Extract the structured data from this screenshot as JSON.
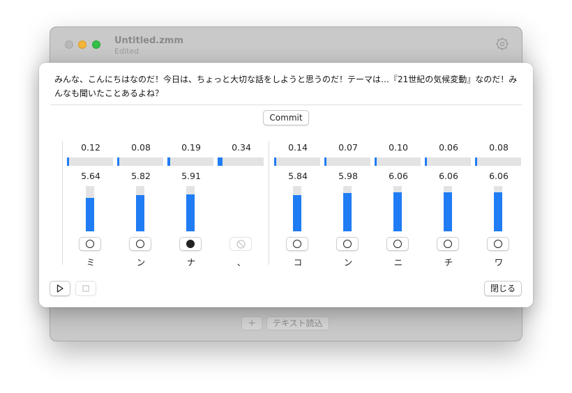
{
  "window": {
    "title": "Untitled.zmm",
    "subtitle": "Edited",
    "settings_icon": "gear-icon",
    "bottom_add_label": "＋",
    "bottom_read_label": "テキスト読込"
  },
  "sheet": {
    "text": "みんな、こんにちはなのだ！今日は、ちょっと大切な話をしようと思うのだ！テーマは…『21世紀の気候変動』なのだ！みんなも聞いたことあるよね？",
    "commit_label": "Commit",
    "close_label": "閉じる",
    "play_icon": "play-icon",
    "stop_icon": "stop-icon"
  },
  "accent_color": "#1f7cf4",
  "columns": [
    {
      "char": "ミ",
      "duration": "0.12",
      "duration_fill": 0.04,
      "pitch": "5.64",
      "pitch_fill": 0.74,
      "radio": "empty"
    },
    {
      "char": "ン",
      "duration": "0.08",
      "duration_fill": 0.03,
      "pitch": "5.82",
      "pitch_fill": 0.8,
      "radio": "empty"
    },
    {
      "char": "ナ",
      "duration": "0.19",
      "duration_fill": 0.06,
      "pitch": "5.91",
      "pitch_fill": 0.82,
      "radio": "selected"
    },
    {
      "char": "、",
      "duration": "0.34",
      "duration_fill": 0.11,
      "pitch": "",
      "pitch_fill": null,
      "radio": "disabled"
    },
    {
      "char": "コ",
      "duration": "0.14",
      "duration_fill": 0.04,
      "pitch": "5.84",
      "pitch_fill": 0.8,
      "radio": "empty"
    },
    {
      "char": "ン",
      "duration": "0.07",
      "duration_fill": 0.02,
      "pitch": "5.98",
      "pitch_fill": 0.84,
      "radio": "empty"
    },
    {
      "char": "ニ",
      "duration": "0.10",
      "duration_fill": 0.03,
      "pitch": "6.06",
      "pitch_fill": 0.86,
      "radio": "empty"
    },
    {
      "char": "チ",
      "duration": "0.06",
      "duration_fill": 0.02,
      "pitch": "6.06",
      "pitch_fill": 0.86,
      "radio": "empty"
    },
    {
      "char": "ワ",
      "duration": "0.08",
      "duration_fill": 0.03,
      "pitch": "6.06",
      "pitch_fill": 0.86,
      "radio": "empty"
    }
  ]
}
